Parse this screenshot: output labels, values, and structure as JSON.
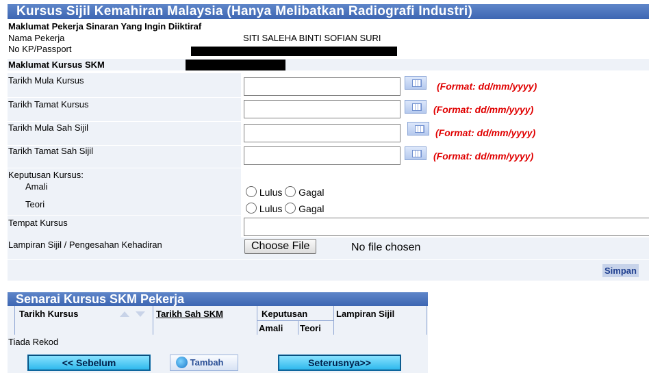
{
  "header": {
    "title": "Kursus Sijil Kemahiran Malaysia (Hanya Melibatkan Radiografi Industri)"
  },
  "worker": {
    "section": "Maklumat Pekerja Sinaran Yang Ingin Diiktiraf",
    "name_label": "Nama Pekerja",
    "name_value": "SITI SALEHA BINTI SOFIAN SURI",
    "id_label": "No KP/Passport"
  },
  "course": {
    "section": "Maklumat Kursus SKM",
    "start_label": "Tarikh Mula Kursus",
    "end_label": "Tarikh  Tamat Kursus",
    "valid_start_label": "Tarikh Mula Sah Sijil",
    "valid_end_label": "Tarikh Tamat Sah Sijil",
    "date_format_hint": "(Format: dd/mm/yyyy)",
    "result_label": "Keputusan Kursus:",
    "practical_label": "Amali",
    "theory_label": "Teori",
    "pass_label": "Lulus",
    "fail_label": "Gagal",
    "venue_label": "Tempat Kursus",
    "attachment_label": "Lampiran Sijil / Pengesahan Kehadiran",
    "choose_file": "Choose File",
    "no_file": "No file chosen",
    "save": "Simpan"
  },
  "list": {
    "title": "Senarai Kursus SKM Pekerja",
    "col_date": "Tarikh Kursus",
    "col_valid": "Tarikh Sah SKM",
    "col_result": "Keputusan",
    "col_practical": "Amali",
    "col_theory": "Teori",
    "col_attachment": "Lampiran Sijil",
    "empty": "Tiada Rekod",
    "prev": "<< Sebelum",
    "add": "Tambah",
    "next": "Seterusnya>>"
  },
  "colors": {
    "header_bg": "#4670bb",
    "hint_red": "#e00000",
    "nav_button": "#2ab6ec"
  }
}
